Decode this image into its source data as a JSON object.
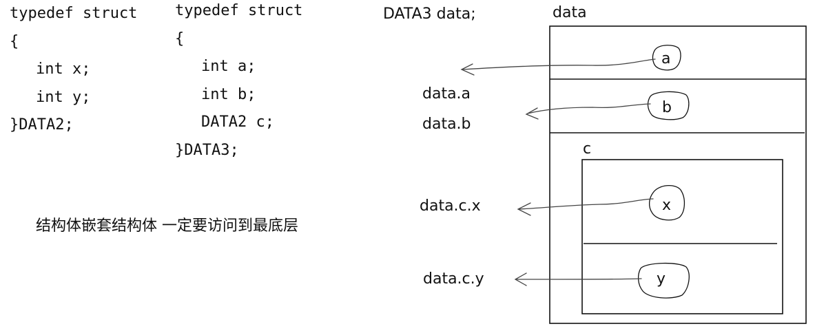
{
  "code_left": {
    "lines": [
      "typedef struct",
      "{",
      "int x;",
      "int y;",
      "}DATA2;"
    ]
  },
  "code_right": {
    "lines": [
      "typedef struct",
      "{",
      "int a;",
      "int b;",
      "DATA2 c;",
      "}DATA3;"
    ]
  },
  "declaration": "DATA3  data;",
  "memory": {
    "title": "data",
    "fields": {
      "a": "a",
      "b": "b",
      "c": "c",
      "x": "x",
      "y": "y"
    }
  },
  "access": {
    "a": "data.a",
    "b": "data.b",
    "cx": "data.c.x",
    "cy": "data.c.y"
  },
  "note": "结构体嵌套结构体 一定要访问到最底层"
}
